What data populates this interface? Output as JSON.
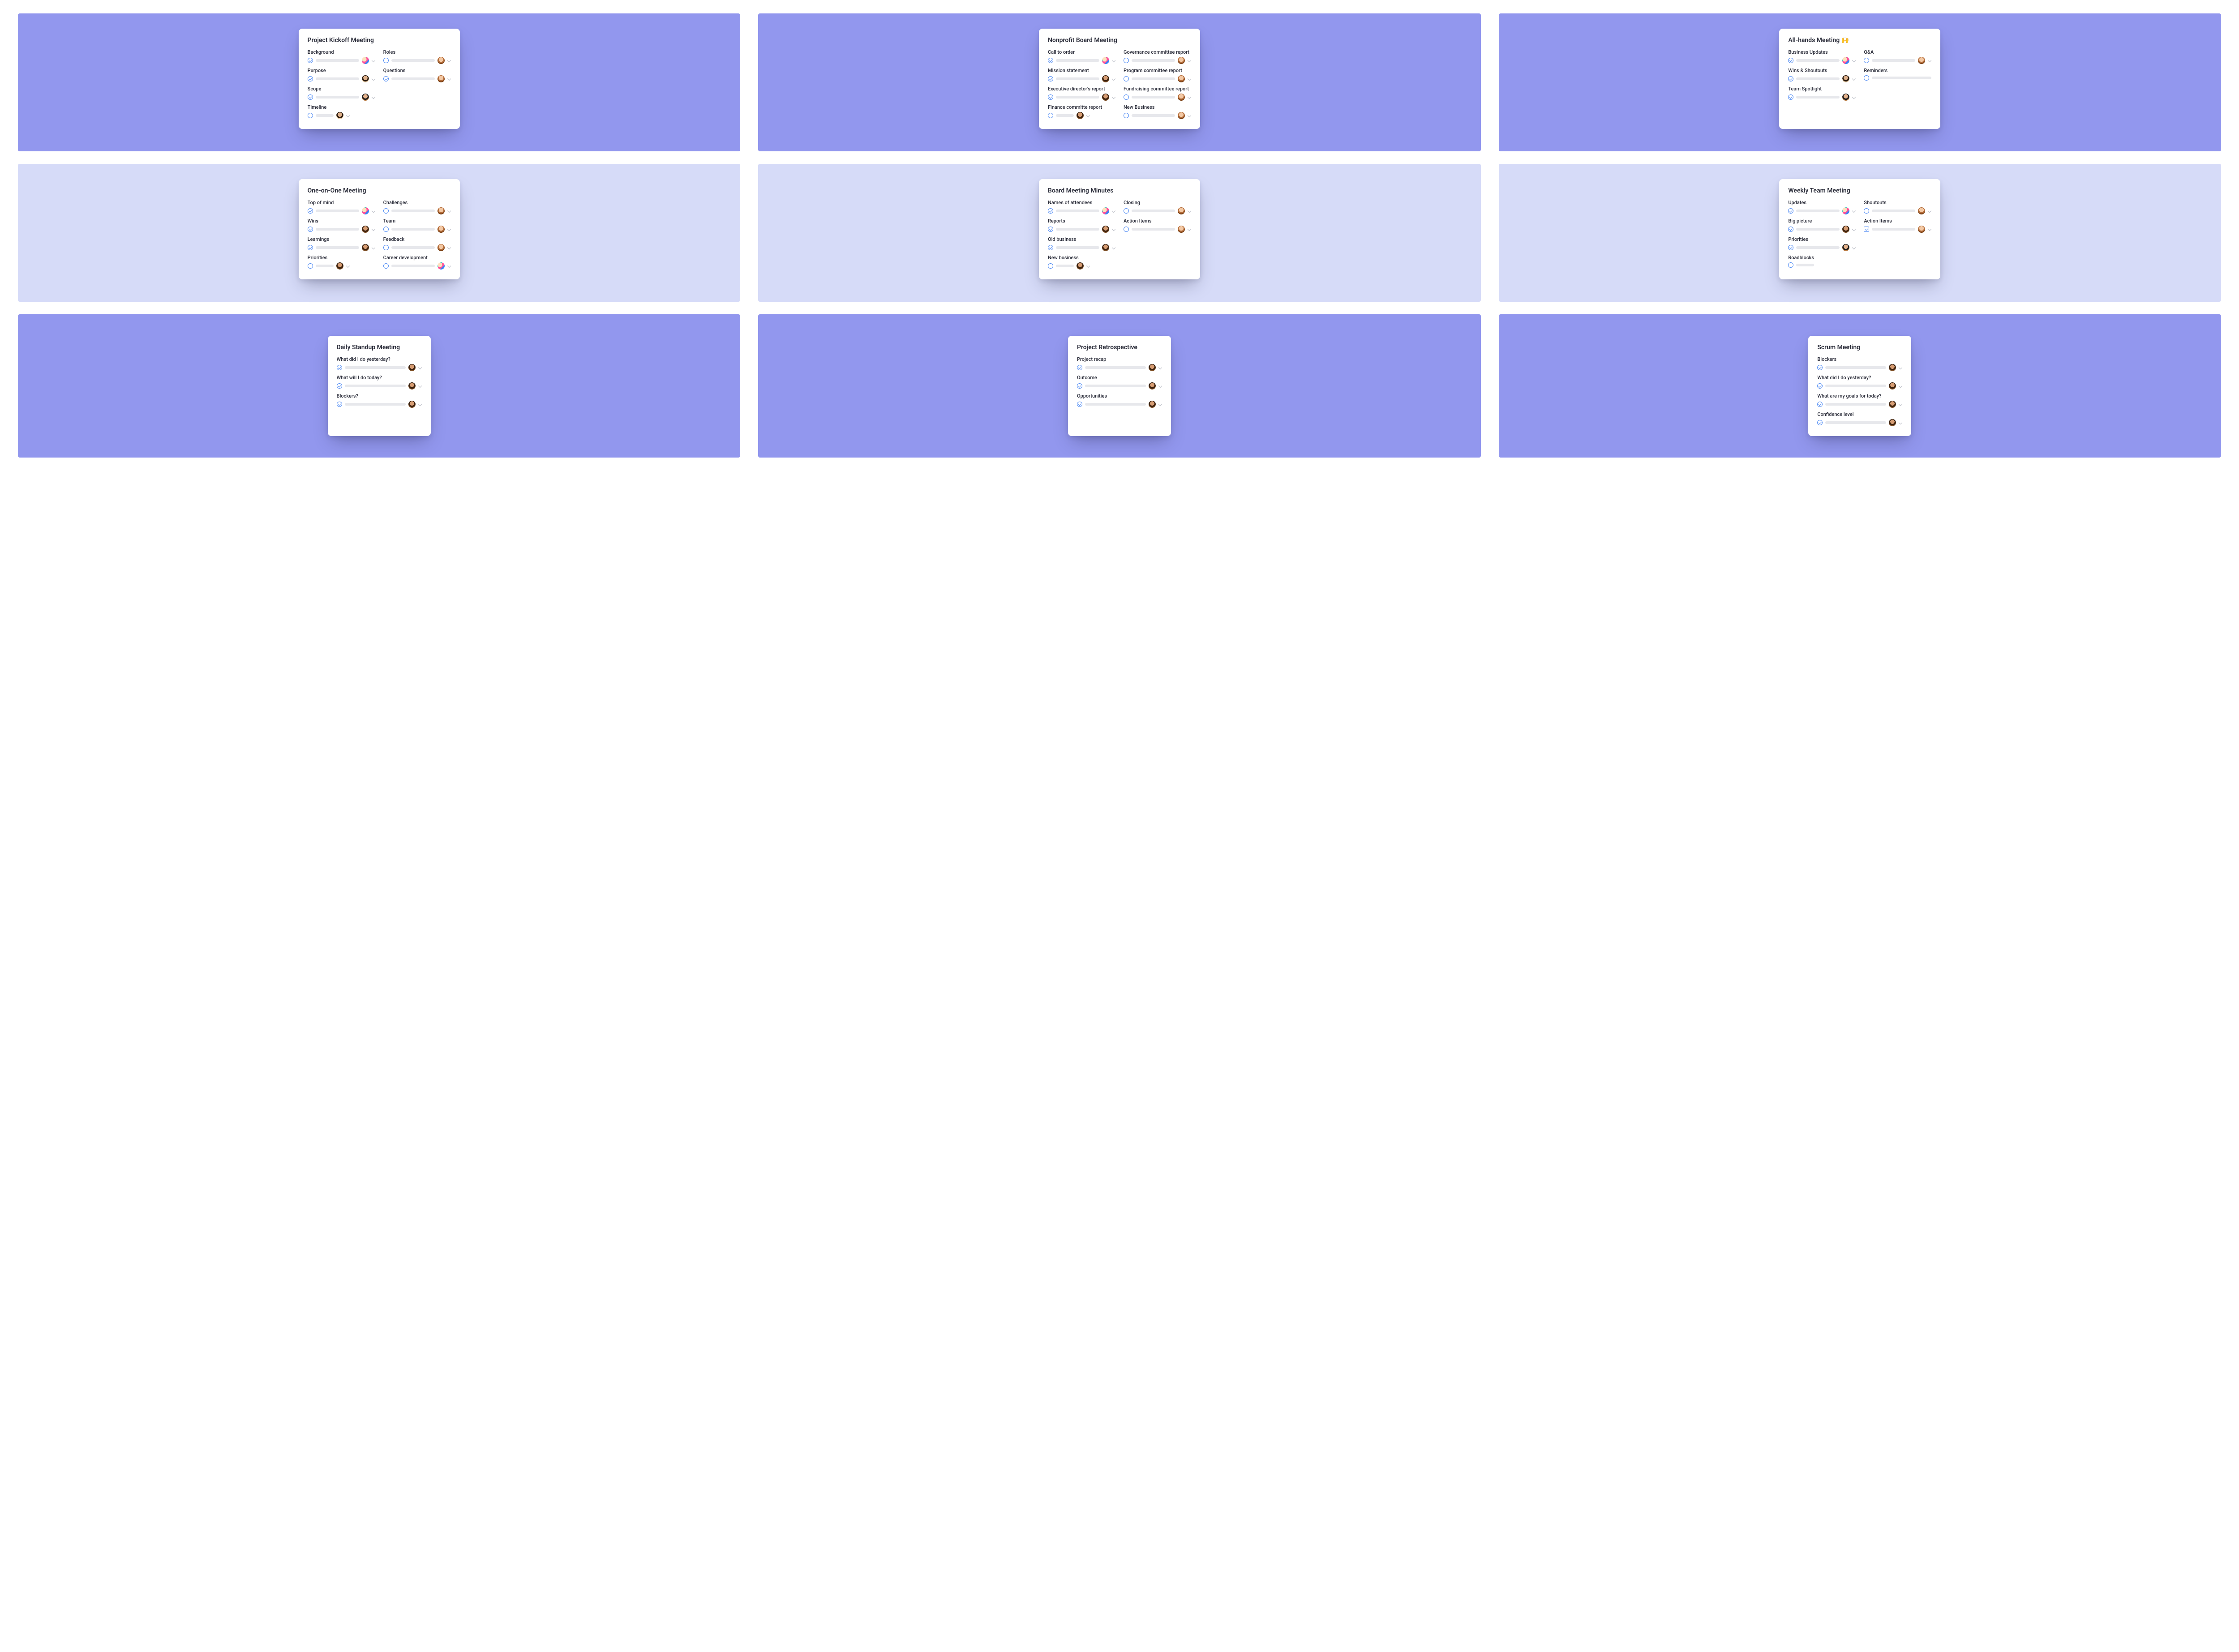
{
  "avatar_styles": {
    "a": "av-a",
    "b": "av-b",
    "c": "av-c",
    "d": "av-d",
    "e": "av-e"
  },
  "tiles": [
    {
      "bg": "a",
      "title": "Project Kickoff Meeting",
      "columns": 2,
      "left": [
        {
          "label": "Background",
          "status": "done",
          "avatar": "a",
          "bar": "long"
        },
        {
          "label": "Purpose",
          "status": "done",
          "avatar": "c",
          "bar": "long"
        },
        {
          "label": "Scope",
          "status": "done",
          "avatar": "e",
          "bar": "long"
        },
        {
          "label": "Timeline",
          "status": "open",
          "avatar": "c",
          "bar": "short"
        }
      ],
      "right": [
        {
          "label": "Roles",
          "status": "open",
          "avatar": "b",
          "bar": "long"
        },
        {
          "label": "Questions",
          "status": "done",
          "avatar": "b",
          "bar": "long"
        }
      ]
    },
    {
      "bg": "a",
      "title": "Nonprofit Board Meeting",
      "columns": 2,
      "left": [
        {
          "label": "Call to order",
          "status": "done",
          "avatar": "a",
          "bar": "long"
        },
        {
          "label": "Mission statement",
          "status": "done",
          "avatar": "d",
          "bar": "long"
        },
        {
          "label": "Executive director's report",
          "status": "done",
          "avatar": "d",
          "bar": "long"
        },
        {
          "label": "Finance committe report",
          "status": "open",
          "avatar": "d",
          "bar": "short"
        }
      ],
      "right": [
        {
          "label": "Governance committee report",
          "status": "open",
          "avatar": "b",
          "bar": "long"
        },
        {
          "label": "Program committee report",
          "status": "open",
          "avatar": "b",
          "bar": "long"
        },
        {
          "label": "Fundraising committee report",
          "status": "open",
          "avatar": "b",
          "bar": "long"
        },
        {
          "label": "New Business",
          "status": "open",
          "avatar": "b",
          "bar": "long"
        }
      ]
    },
    {
      "bg": "a",
      "title": "All-hands Meeting 🙌",
      "columns": 2,
      "left": [
        {
          "label": "Business Updates",
          "status": "done",
          "avatar": "a",
          "bar": "long"
        },
        {
          "label": "Wins & Shoutouts",
          "status": "done",
          "avatar": "c",
          "bar": "long"
        },
        {
          "label": "Team Spotlight",
          "status": "done",
          "avatar": "e",
          "bar": "long"
        }
      ],
      "right": [
        {
          "label": "Q&A",
          "status": "open",
          "avatar": "b",
          "bar": "long"
        },
        {
          "label": "Reminders",
          "status": "open",
          "avatar": null,
          "bar": "long"
        }
      ]
    },
    {
      "bg": "b",
      "title": "One-on-One Meeting",
      "columns": 2,
      "left": [
        {
          "label": "Top of mind",
          "status": "done",
          "avatar": "a",
          "bar": "long"
        },
        {
          "label": "Wins",
          "status": "done",
          "avatar": "d",
          "bar": "long"
        },
        {
          "label": "Learnings",
          "status": "done",
          "avatar": "d",
          "bar": "long"
        },
        {
          "label": "Priorities",
          "status": "open",
          "avatar": "d",
          "bar": "short"
        }
      ],
      "right": [
        {
          "label": "Challenges",
          "status": "open",
          "avatar": "b",
          "bar": "long"
        },
        {
          "label": "Team",
          "status": "open",
          "avatar": "b",
          "bar": "long"
        },
        {
          "label": "Feedback",
          "status": "open",
          "avatar": "b",
          "bar": "long"
        },
        {
          "label": "Career development",
          "status": "open",
          "avatar": "a",
          "bar": "long"
        }
      ]
    },
    {
      "bg": "b",
      "title": "Board Meeting Minutes",
      "columns": 2,
      "left": [
        {
          "label": "Names of attendees",
          "status": "done",
          "avatar": "a",
          "bar": "long"
        },
        {
          "label": "Reports",
          "status": "done",
          "avatar": "d",
          "bar": "long"
        },
        {
          "label": "Old business",
          "status": "done",
          "avatar": "d",
          "bar": "long"
        },
        {
          "label": "New business",
          "status": "open",
          "avatar": "d",
          "bar": "short"
        }
      ],
      "right": [
        {
          "label": "Closing",
          "status": "open",
          "avatar": "b",
          "bar": "long"
        },
        {
          "label": "Action Items",
          "status": "open",
          "avatar": "b",
          "bar": "long"
        }
      ]
    },
    {
      "bg": "b",
      "title": "Weekly Team Meeting",
      "columns": 2,
      "left": [
        {
          "label": "Updates",
          "status": "done",
          "avatar": "a",
          "bar": "long"
        },
        {
          "label": "Big picture",
          "status": "done",
          "avatar": "d",
          "bar": "long"
        },
        {
          "label": "Priorities",
          "status": "done",
          "avatar": "e",
          "bar": "long"
        },
        {
          "label": "Roadblocks",
          "status": "open",
          "avatar": null,
          "bar": "short"
        }
      ],
      "right": [
        {
          "label": "Shoutouts",
          "status": "open",
          "avatar": "b",
          "bar": "long"
        },
        {
          "label": "Action Items",
          "status": "square-done",
          "avatar": "b",
          "bar": "long"
        }
      ]
    },
    {
      "bg": "a",
      "row": 3,
      "narrow": true,
      "title": "Daily Standup Meeting",
      "columns": 1,
      "left": [
        {
          "label": "What did I do yesterday?",
          "status": "done",
          "avatar": "d",
          "bar": "long"
        },
        {
          "label": "What will I do today?",
          "status": "done",
          "avatar": "d",
          "bar": "long"
        },
        {
          "label": "Blockers?",
          "status": "done",
          "avatar": "d",
          "bar": "long"
        }
      ]
    },
    {
      "bg": "a",
      "row": 3,
      "narrow": true,
      "title": "Project Retrospective",
      "columns": 1,
      "left": [
        {
          "label": "Project recap",
          "status": "done",
          "avatar": "d",
          "bar": "long"
        },
        {
          "label": "Outcome",
          "status": "done",
          "avatar": "d",
          "bar": "long"
        },
        {
          "label": "Opportunities",
          "status": "done",
          "avatar": "d",
          "bar": "long"
        }
      ]
    },
    {
      "bg": "a",
      "row": 3,
      "narrow": true,
      "title": "Scrum Meeting",
      "columns": 1,
      "left": [
        {
          "label": "Blockers",
          "status": "done",
          "avatar": "d",
          "bar": "long"
        },
        {
          "label": "What did I do yesterday?",
          "status": "done",
          "avatar": "d",
          "bar": "long"
        },
        {
          "label": "What are my goals for today?",
          "status": "done",
          "avatar": "d",
          "bar": "long"
        },
        {
          "label": "Confidence level",
          "status": "done",
          "avatar": "d",
          "bar": "long"
        }
      ]
    }
  ]
}
